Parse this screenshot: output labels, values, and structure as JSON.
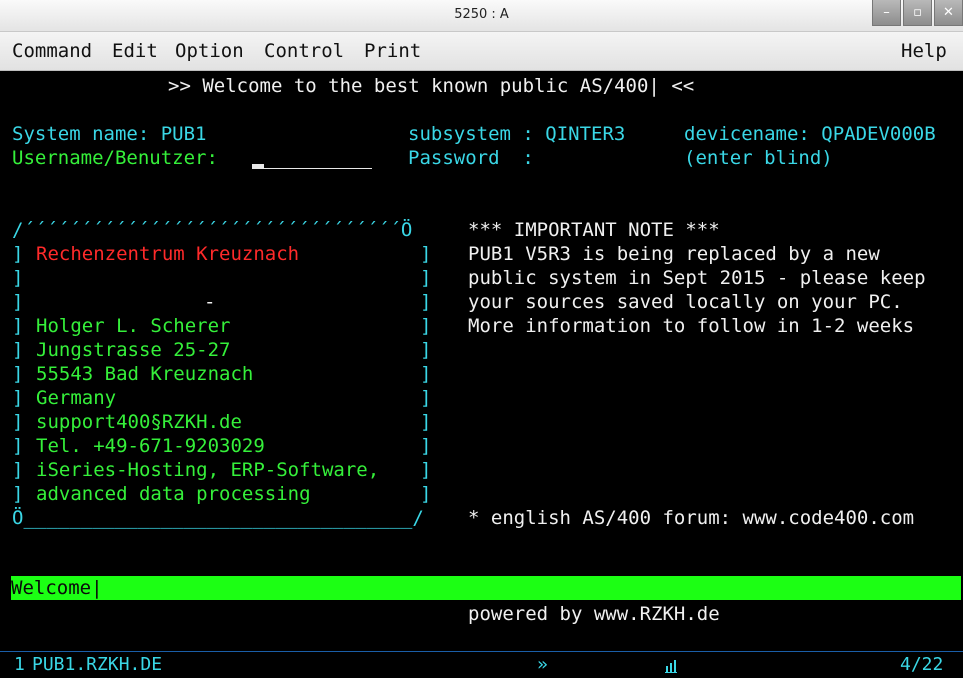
{
  "window": {
    "title": "5250 : A",
    "controls": [
      "–",
      "▫",
      "✕"
    ]
  },
  "menu": {
    "command": "Command",
    "edit": "Edit",
    "option": "Option",
    "control": "Control",
    "print": "Print",
    "help": "Help"
  },
  "screen": {
    "welcome_line": ">> Welcome to the best known public AS/400| <<",
    "system_name_label": "System name: PUB1",
    "subsystem_label": "subsystem : QINTER3",
    "devicename_label": "devicename: QPADEV000B",
    "username_label": "Username/Benutzer:",
    "username_value": "",
    "password_label": "Password  :",
    "password_value": "",
    "enter_blind": "(enter blind)",
    "box": {
      "top": "/´´´´´´´´´´´´´´´´´´´´´´´´´´´´´´´´´Ö",
      "bottom": "Ö__________________________________/",
      "left_bracket": "]",
      "right_bracket": "]",
      "dash": "-",
      "lines": {
        "company": "Rechenzentrum Kreuznach",
        "name": "Holger L. Scherer",
        "street": "Jungstrasse 25-27",
        "city": "55543 Bad Kreuznach",
        "country": "Germany",
        "email": "support400§RZKH.de",
        "phone": "Tel. +49-671-9203029",
        "services1": "iSeries-Hosting, ERP-Software,",
        "services2": "advanced data processing"
      }
    },
    "note": {
      "header": "*** IMPORTANT NOTE ***",
      "line1": "PUB1 V5R3 is being replaced by a new",
      "line2": "public system in Sept 2015 - please keep",
      "line3": "your sources saved locally on your PC.",
      "line4": "More information to follow in 1-2 weeks"
    },
    "forum": "* english AS/400 forum: www.code400.com",
    "status_message": "Welcome|",
    "powered_by": "powered by www.RZKH.de"
  },
  "oia": {
    "session": "1",
    "host": "PUB1.RZKH.DE",
    "indicator": "»",
    "lock_icon": "keyboard-indicator-icon",
    "cursor_pos": "4/22"
  },
  "colors": {
    "green": "#35f03a",
    "cyan": "#3ad7e6",
    "red": "#ff2a2a",
    "white": "#f0f0f0",
    "status_bar": "#1cff14"
  }
}
